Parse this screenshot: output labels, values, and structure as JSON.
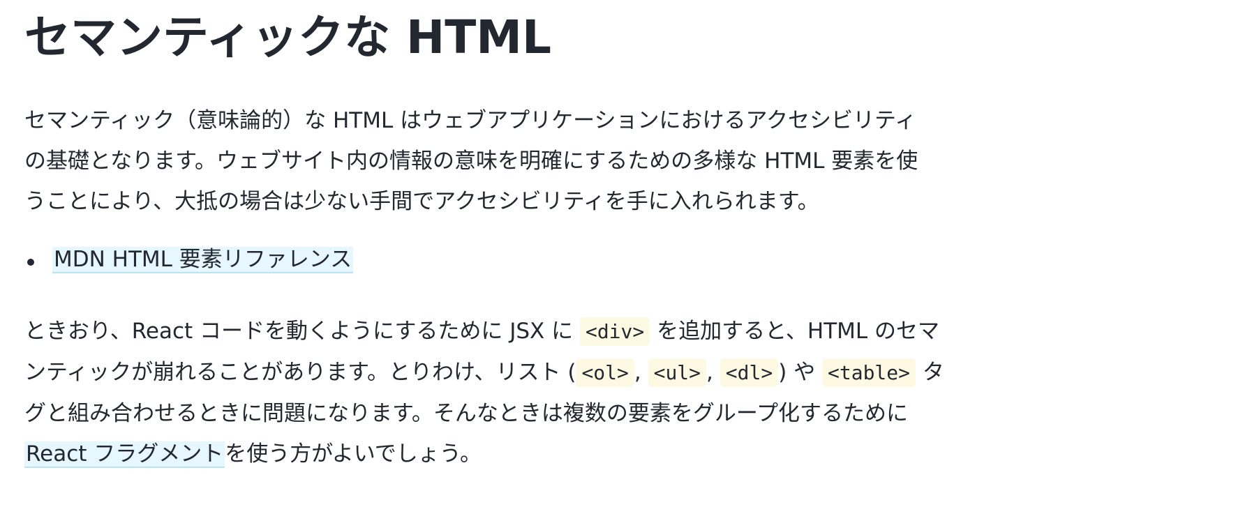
{
  "page": {
    "title": "セマンティックな HTML"
  },
  "intro": {
    "line1": "セマンティック（意味論的）な HTML はウェブアプリケーションにおけるアクセシビリティ",
    "line2": "の基礎となります。ウェブサイト内の情報の意味を明確にするための多様な HTML 要素を使",
    "line3": "うことにより、大抵の場合は少ない手間でアクセシビリティを手に入れられます。"
  },
  "links": {
    "mdn_reference": "MDN HTML 要素リファレンス",
    "react_fragment": "React フラグメント"
  },
  "fragment_paragraph": {
    "part1": "ときおり、React コードを動くようにするために JSX に ",
    "code_div": "<div>",
    "part2": " を追加すると、HTML のセマ",
    "part3": "ンティックが崩れることがあります。とりわけ、リスト (",
    "code_ol": "<ol>",
    "comma1": ", ",
    "code_ul": "<ul>",
    "comma2": ", ",
    "code_dl": "<dl>",
    "part4": ") や ",
    "code_table": "<table>",
    "part5": " タ",
    "part6": "グと組み合わせるときに問題になります。そんなときは複数の要素をグループ化するために",
    "part7": "を使う方がよいでしょう。"
  }
}
